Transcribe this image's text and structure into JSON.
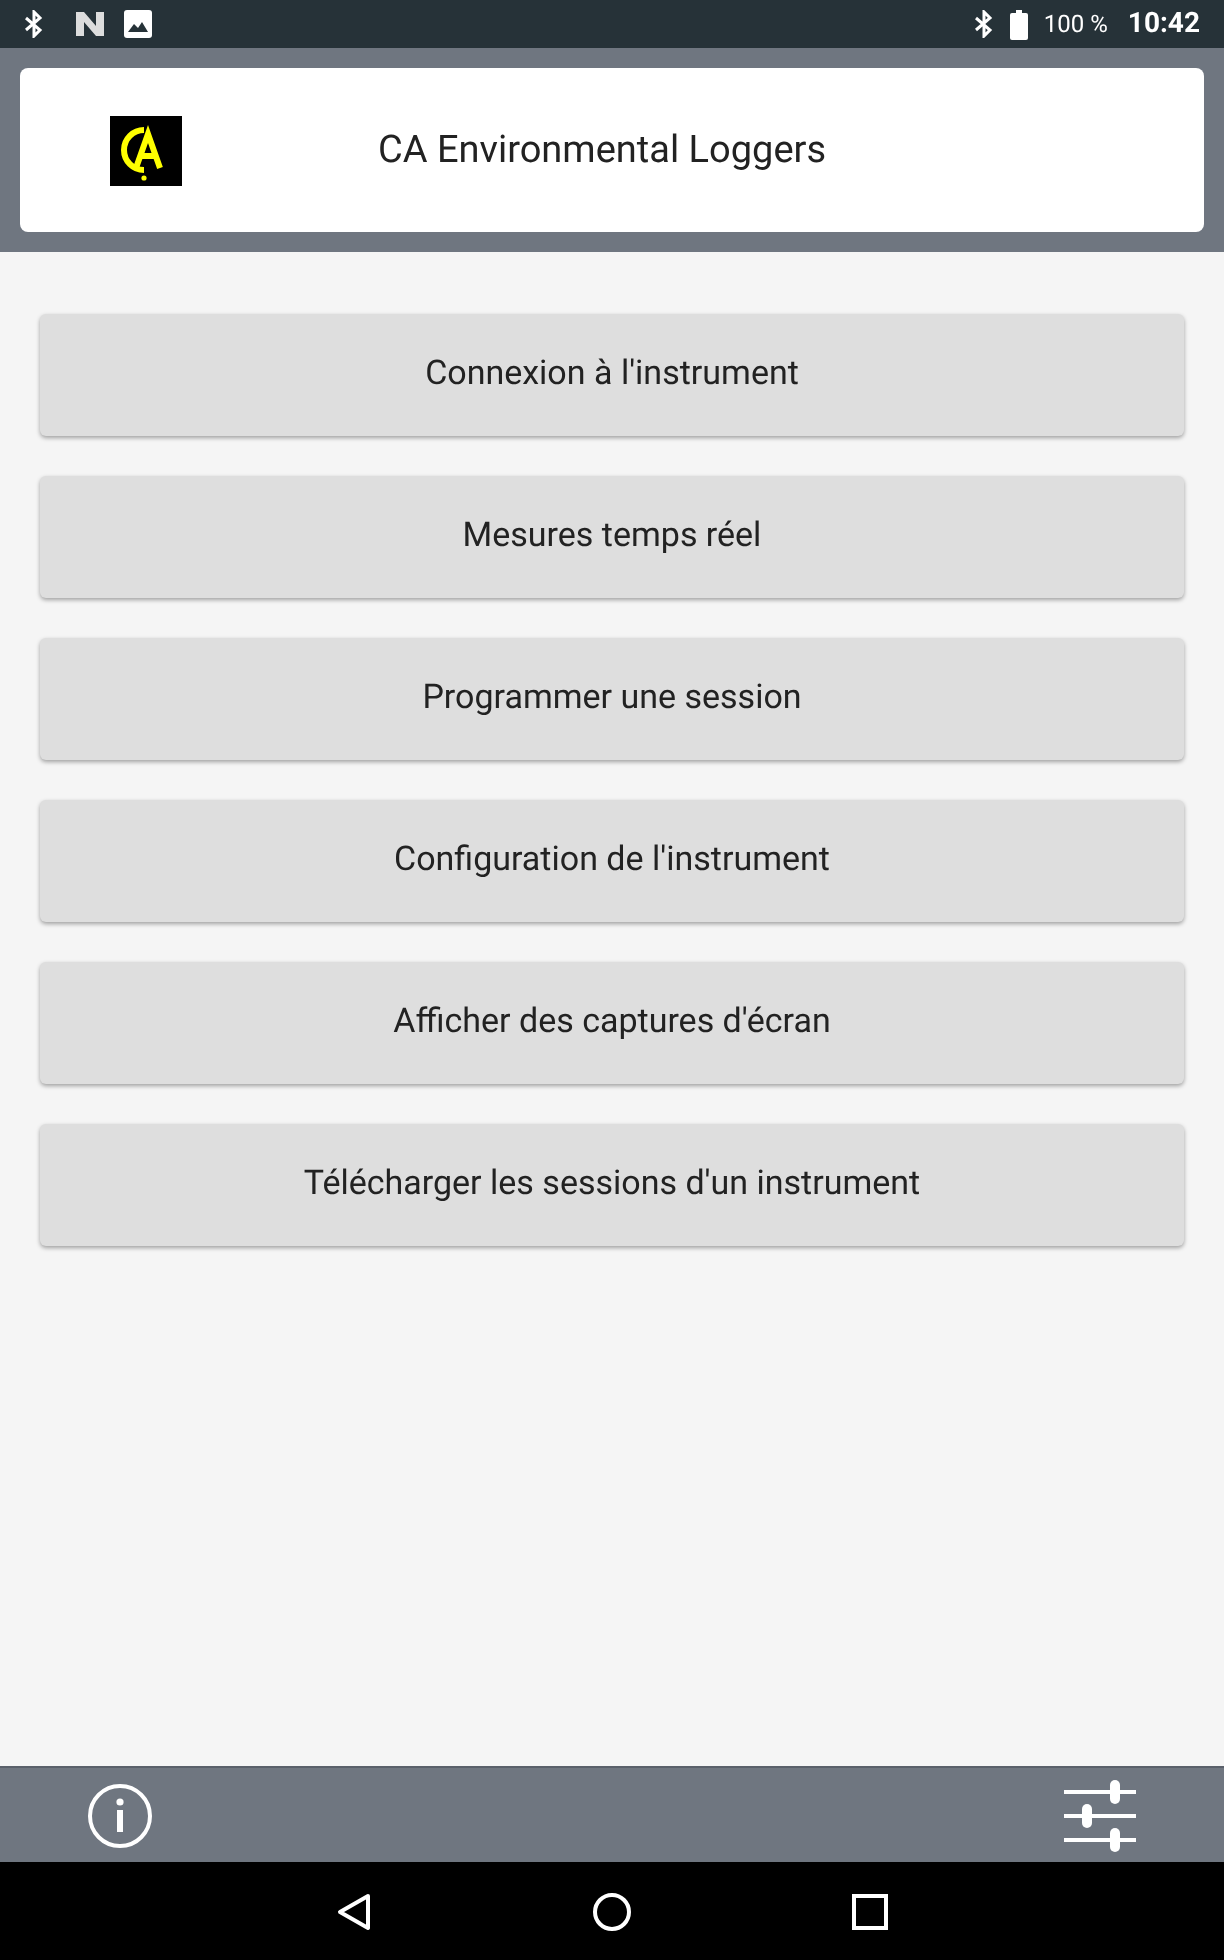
{
  "status_bar": {
    "battery": "100 %",
    "time": "10:42"
  },
  "header": {
    "title": "CA Environmental Loggers"
  },
  "menu": [
    {
      "label": "Connexion à l'instrument"
    },
    {
      "label": "Mesures temps réel"
    },
    {
      "label": "Programmer une session"
    },
    {
      "label": "Configuration de l'instrument"
    },
    {
      "label": "Afficher des captures d'écran"
    },
    {
      "label": "Télécharger les sessions d'un instrument"
    }
  ]
}
